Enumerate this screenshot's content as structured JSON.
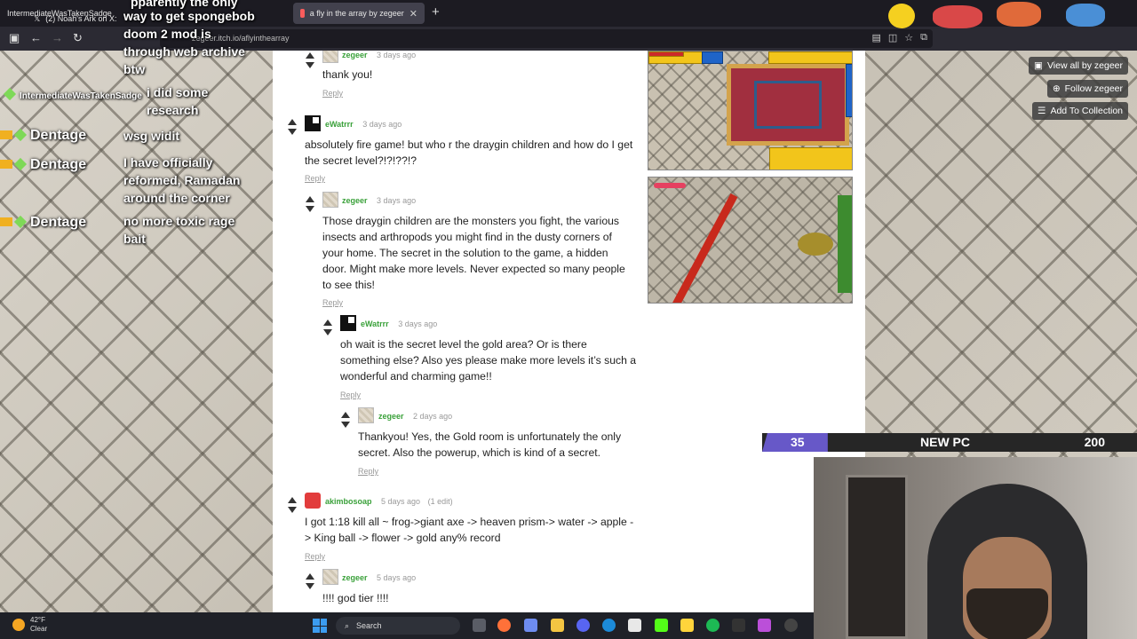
{
  "browser": {
    "tabs": [
      {
        "label": "IntermediateWasTakenSadge"
      },
      {
        "label": "(2) Noah's Ark on X:"
      },
      {
        "label": "a fly in the array by zegeer"
      }
    ],
    "url": "zegeer.itch.io/aflyinthearray"
  },
  "sidebar": {
    "view_all": "View all by zegeer",
    "follow": "Follow zegeer",
    "add_collection": "Add To Collection"
  },
  "comments": [
    {
      "user": "zegeer",
      "time": "3 days ago",
      "edit": "",
      "text": "thank you!",
      "reply": "Reply"
    },
    {
      "user": "eWatrrr",
      "time": "3 days ago",
      "edit": "",
      "text": "absolutely fire game! but who r the draygin children and how do I get the secret level?!?!??!?",
      "reply": "Reply"
    },
    {
      "user": "zegeer",
      "time": "3 days ago",
      "edit": "",
      "text": "Those draygin children are the monsters you fight, the various insects and arthropods you might find in the dusty corners of your home. The secret in the solution to the game, a hidden door. Might make more levels. Never expected so many people to see this!",
      "reply": "Reply"
    },
    {
      "user": "eWatrrr",
      "time": "3 days ago",
      "edit": "",
      "text": "oh wait is the secret level the gold area? Or is there something else? Also yes please make more levels it’s such a wonderful and charming game!!",
      "reply": "Reply"
    },
    {
      "user": "zegeer",
      "time": "2 days ago",
      "edit": "",
      "text": "Thankyou! Yes, the Gold room is unfortunately the only secret. Also the powerup, which is kind of a secret.",
      "reply": "Reply"
    },
    {
      "user": "akimbosoap",
      "time": "5 days ago",
      "edit": "(1 edit)",
      "text": "I got 1:18 kill all ~ frog->giant axe -> heaven prism-> water -> apple -> King ball -> flower -> gold any% record",
      "reply": "Reply"
    },
    {
      "user": "zegeer",
      "time": "5 days ago",
      "edit": "",
      "text": "!!!! god tier !!!!",
      "reply": "Reply"
    }
  ],
  "chat": {
    "lines": [
      {
        "user": "",
        "text": "pparently the only"
      },
      {
        "user": "",
        "text": "way to get spongebob"
      },
      {
        "user": "",
        "text": "doom 2 mod is"
      },
      {
        "user": "",
        "text": "through web archive"
      },
      {
        "user": "",
        "text": "btw"
      },
      {
        "user": "IntermediateWasTakenSadge",
        "text": "i did some"
      },
      {
        "user": "",
        "text": "research"
      },
      {
        "user": "Dentage",
        "text": "wsg widit"
      },
      {
        "user": "Dentage",
        "text": "I have officially"
      },
      {
        "user": "",
        "text": "reformed, Ramadan"
      },
      {
        "user": "",
        "text": "around the corner"
      },
      {
        "user": "Dentage",
        "text": "no more toxic rage"
      },
      {
        "user": "",
        "text": "bait"
      }
    ]
  },
  "goal": {
    "current": "35",
    "label": "NEW PC",
    "target": "200",
    "progress_fraction": 0.175,
    "fill_color": "#6758c8"
  },
  "taskbar": {
    "temp": "42°F",
    "condition": "Clear",
    "search": "Search"
  }
}
